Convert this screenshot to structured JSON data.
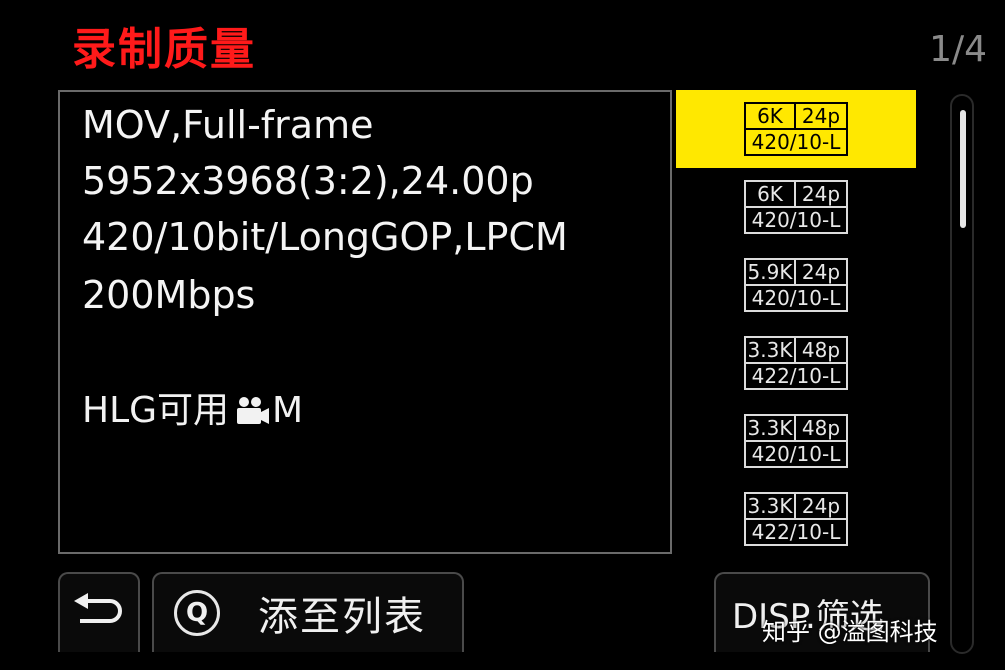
{
  "header": {
    "title": "录制质量",
    "page_indicator": "1/4"
  },
  "info": {
    "lines": [
      "MOV,Full-frame",
      "5952x3968(3:2),24.00p",
      "420/10bit/LongGOP,LPCM",
      "200Mbps"
    ],
    "hlg_label": "HLG可用",
    "hlg_mode": "M",
    "hlg_icon": "movie-camera-icon"
  },
  "list": {
    "selected_index": 0,
    "items": [
      {
        "res": "6K",
        "fps": "24p",
        "format": "420/10-L"
      },
      {
        "res": "6K",
        "fps": "24p",
        "format": "420/10-L"
      },
      {
        "res": "5.9K",
        "fps": "24p",
        "format": "420/10-L"
      },
      {
        "res": "3.3K",
        "fps": "48p",
        "format": "422/10-L"
      },
      {
        "res": "3.3K",
        "fps": "48p",
        "format": "420/10-L"
      },
      {
        "res": "3.3K",
        "fps": "24p",
        "format": "422/10-L"
      }
    ]
  },
  "scrollbar": {
    "position_fraction": 0.0,
    "visible_fraction": 0.25
  },
  "footer": {
    "back_icon": "return-arrow-icon",
    "q_label": "Q",
    "add_label": "添至列表",
    "disp_label": "DISP.筛选"
  },
  "watermark": "知乎 @溢图科技",
  "colors": {
    "title": "#ff1a1a",
    "selected_bg": "#ffe800",
    "background": "#000000"
  }
}
